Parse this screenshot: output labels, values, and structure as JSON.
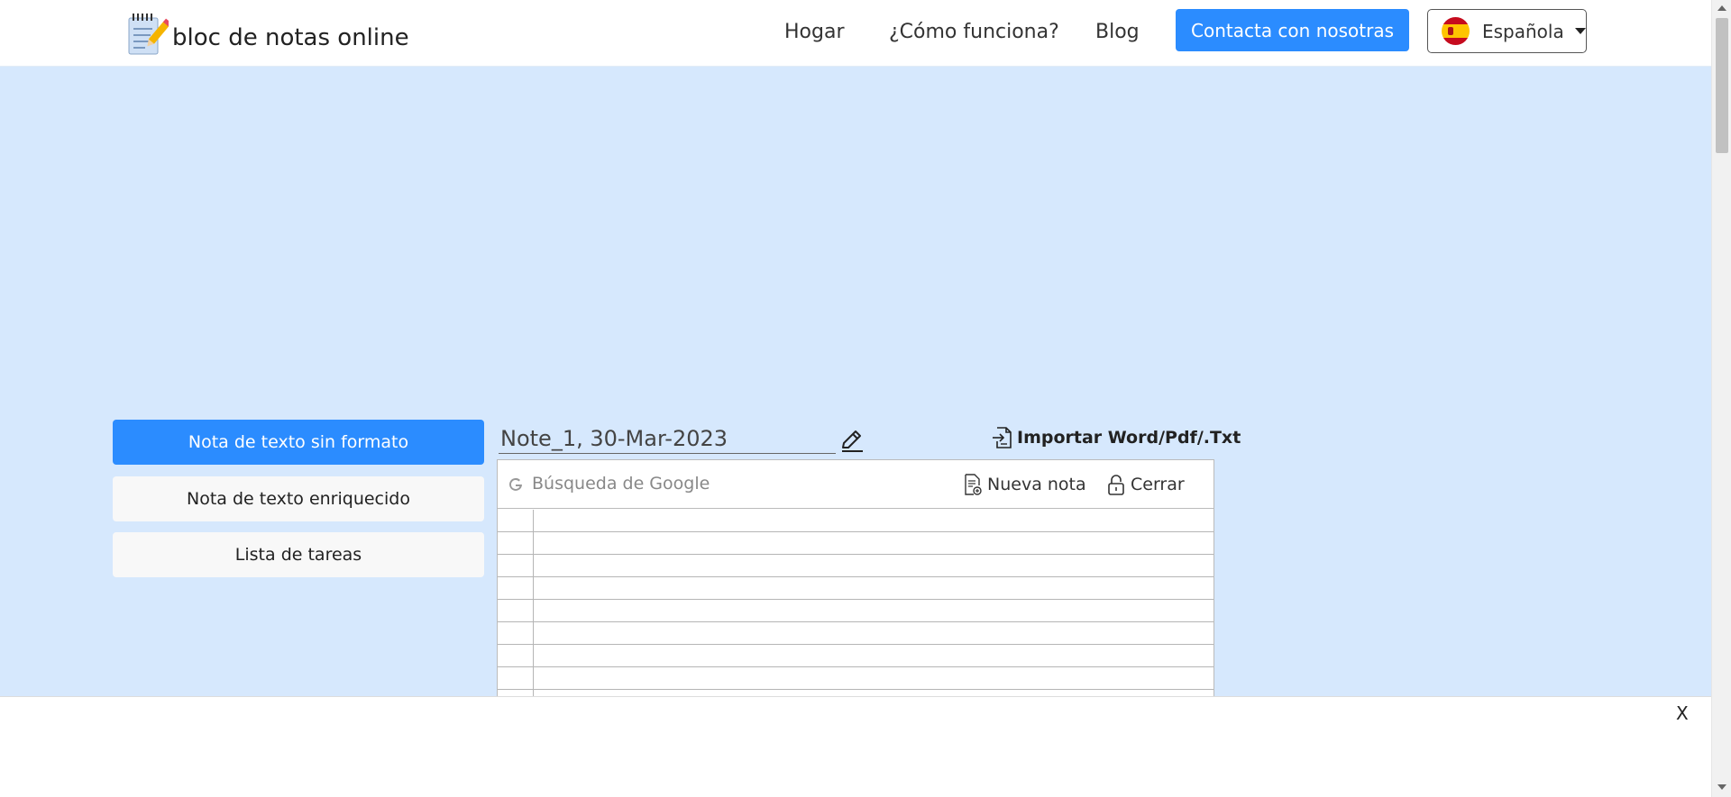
{
  "header": {
    "logo_text": "bloc de notas online",
    "nav": {
      "home": "Hogar",
      "how": "¿Cómo funciona?",
      "blog": "Blog"
    },
    "contact_button": "Contacta con nosotras",
    "language": "Española"
  },
  "sidebar": {
    "items": [
      {
        "label": "Nota de texto sin formato",
        "active": true
      },
      {
        "label": "Nota de texto enriquecido",
        "active": false
      },
      {
        "label": "Lista de tareas",
        "active": false
      }
    ]
  },
  "note": {
    "title": "Note_1, 30-Mar-2023",
    "import_label": "Importar Word/Pdf/.Txt",
    "search_placeholder": "Búsqueda de Google",
    "new_note_label": "Nueva nota",
    "close_label": "Cerrar"
  },
  "ad": {
    "close_label": "X"
  },
  "colors": {
    "background": "#d6e8fd",
    "accent": "#2b8cff",
    "header_bg": "#ffffff"
  }
}
